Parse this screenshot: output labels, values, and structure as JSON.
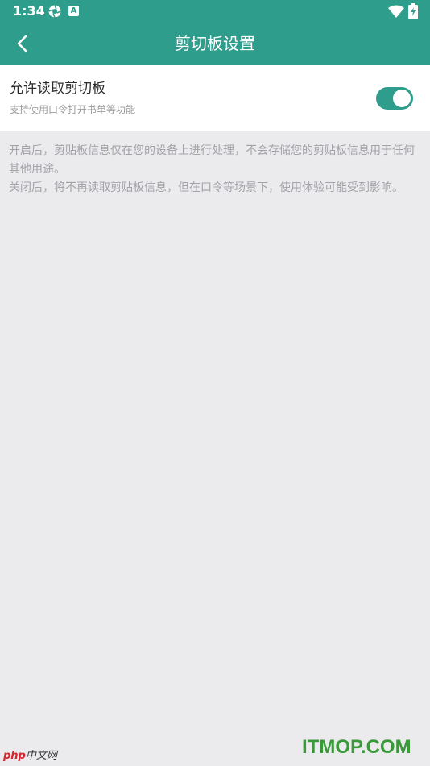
{
  "status_bar": {
    "time": "1:34",
    "notification_badge": "A",
    "icons": [
      "aperture-icon",
      "a-badge-icon",
      "wifi-icon",
      "battery-charging-icon"
    ]
  },
  "app_bar": {
    "title": "剪切板设置",
    "back_icon": "chevron-left-icon",
    "background_color": "#2e9d8b"
  },
  "setting": {
    "title": "允许读取剪切板",
    "subtitle": "支持使用口令打开书单等功能",
    "toggle_on": true,
    "toggle_color": "#2e9d8b"
  },
  "info": {
    "paragraph_1": "开启后，剪贴板信息仅在您的设备上进行处理，不会存储您的剪贴板信息用于任何其他用途。",
    "paragraph_2": " 关闭后，将不再读取剪贴板信息，但在口令等场景下，使用体验可能受到影响。"
  },
  "watermarks": {
    "left_brand": "php",
    "left_text": "中文网",
    "right_text": "ITMOP.COM"
  }
}
